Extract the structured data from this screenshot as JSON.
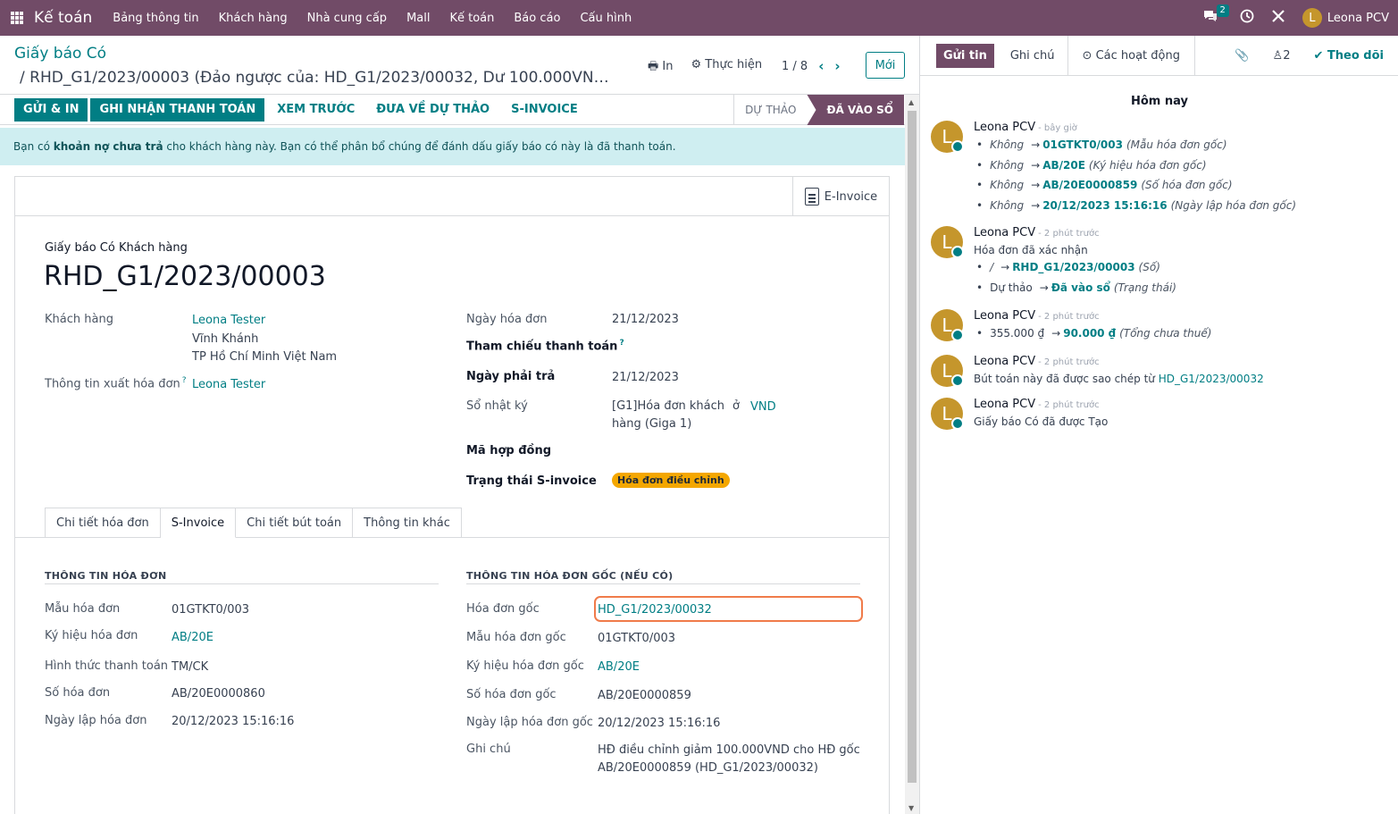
{
  "topbar": {
    "app_name": "Kế toán",
    "menu": [
      "Bảng thông tin",
      "Khách hàng",
      "Nhà cung cấp",
      "Mall",
      "Kế toán",
      "Báo cáo",
      "Cấu hình"
    ],
    "chat_count": "2",
    "user_initial": "L",
    "user_name": "Leona PCV"
  },
  "control": {
    "breadcrumb_parent": "Giấy báo Có",
    "breadcrumb_current": "/ RHD_G1/2023/00003 (Đảo ngược của: HD_G1/2023/00032, Dư 100.000VN…",
    "print_label": "In",
    "action_label": "Thực hiện",
    "pager": "1 / 8",
    "new_label": "Mới"
  },
  "statusbar": {
    "buttons": [
      "Gửi & In",
      "Ghi nhận thanh toán",
      "Xem trước",
      "Đưa về dự thảo",
      "S-Invoice"
    ],
    "stage_draft": "Dự thảo",
    "stage_posted": "Đã vào sổ"
  },
  "alert": {
    "prefix": "Bạn có ",
    "bold": "khoản nợ chưa trả",
    "suffix": " cho khách hàng này. Bạn có thể phân bổ chúng để đánh dấu giấy báo có này là đã thanh toán."
  },
  "form": {
    "einvoice_label": "E-Invoice",
    "subtitle": "Giấy báo Có Khách hàng",
    "title": "RHD_G1/2023/00003",
    "customer_label": "Khách hàng",
    "customer_name": "Leona Tester",
    "customer_addr1": "Vĩnh Khánh",
    "customer_addr2": "TP Hồ Chí Minh Việt Nam",
    "invoice_info_label": "Thông tin xuất hóa đơn",
    "invoice_info_value": "Leona Tester",
    "invoice_date_label": "Ngày hóa đơn",
    "invoice_date": "21/12/2023",
    "payment_ref_label": "Tham chiếu thanh toán",
    "due_date_label": "Ngày phải trả",
    "due_date": "21/12/2023",
    "journal_label": "Sổ nhật ký",
    "journal_line1": "[G1]Hóa đơn khách",
    "journal_line2": "hàng (Giga 1)",
    "journal_in": "ở",
    "currency": "VND",
    "contract_label": "Mã hợp đồng",
    "sinvoice_status_label": "Trạng thái S-invoice",
    "sinvoice_status": "Hóa đơn điều chỉnh",
    "help_mark": "?"
  },
  "tabs": [
    "Chi tiết hóa đơn",
    "S-Invoice",
    "Chi tiết bút toán",
    "Thông tin khác"
  ],
  "sinvoice": {
    "left_title": "THÔNG TIN HÓA ĐƠN",
    "left": [
      {
        "label": "Mẫu hóa đơn",
        "value": "01GTKT0/003"
      },
      {
        "label": "Ký hiệu hóa đơn",
        "value": "AB/20E"
      },
      {
        "label": "Hình thức thanh toán",
        "value": "TM/CK"
      },
      {
        "label": "Số hóa đơn",
        "value": "AB/20E0000860"
      },
      {
        "label": "Ngày lập hóa đơn",
        "value": "20/12/2023 15:16:16"
      }
    ],
    "right_title": "THÔNG TIN HÓA ĐƠN GỐC (NẾU CÓ)",
    "right": [
      {
        "label": "Hóa đơn gốc",
        "value": "HD_G1/2023/00032"
      },
      {
        "label": "Mẫu hóa đơn gốc",
        "value": "01GTKT0/003"
      },
      {
        "label": "Ký hiệu hóa đơn gốc",
        "value": "AB/20E"
      },
      {
        "label": "Số hóa đơn gốc",
        "value": "AB/20E0000859"
      },
      {
        "label": "Ngày lập hóa đơn gốc",
        "value": "20/12/2023 15:16:16"
      },
      {
        "label": "Ghi chú",
        "value1": "HĐ điều chỉnh giảm 100.000VND cho HĐ gốc",
        "value2": "AB/20E0000859 (HD_G1/2023/00032)"
      }
    ]
  },
  "chatter": {
    "send_label": "Gửi tin",
    "note_label": "Ghi chú",
    "activity_label": "Các hoạt động",
    "followers_count": "2",
    "follow_label": "Theo dõi",
    "today_label": "Hôm nay",
    "messages": [
      {
        "author": "Leona PCV",
        "time": "- bây giờ",
        "changes": [
          {
            "old": "Không",
            "new": "01GTKT0/003",
            "field": "(Mẫu hóa đơn gốc)"
          },
          {
            "old": "Không",
            "new": "AB/20E",
            "field": "(Ký hiệu hóa đơn gốc)"
          },
          {
            "old": "Không",
            "new": "AB/20E0000859",
            "field": "(Số hóa đơn gốc)"
          },
          {
            "old": "Không",
            "new": "20/12/2023 15:16:16",
            "field": "(Ngày lập hóa đơn gốc)"
          }
        ]
      },
      {
        "author": "Leona PCV",
        "time": "- 2 phút trước",
        "body": "Hóa đơn đã xác nhận",
        "changes": [
          {
            "old": "/",
            "new": "RHD_G1/2023/00003",
            "field": "(Số)"
          },
          {
            "old": "Dự thảo",
            "new": "Đã vào sổ",
            "field": "(Trạng thái)"
          }
        ]
      },
      {
        "author": "Leona PCV",
        "time": "- 2 phút trước",
        "changes": [
          {
            "old": "355.000 ₫",
            "new": "90.000 ₫",
            "field": "(Tổng chưa thuế)"
          }
        ]
      },
      {
        "author": "Leona PCV",
        "time": "- 2 phút trước",
        "body": "Bút toán này đã được sao chép từ ",
        "body_link": "HD_G1/2023/00032"
      },
      {
        "author": "Leona PCV",
        "time": "- 2 phút trước",
        "body": "Giấy báo Có đã được Tạo"
      }
    ]
  }
}
